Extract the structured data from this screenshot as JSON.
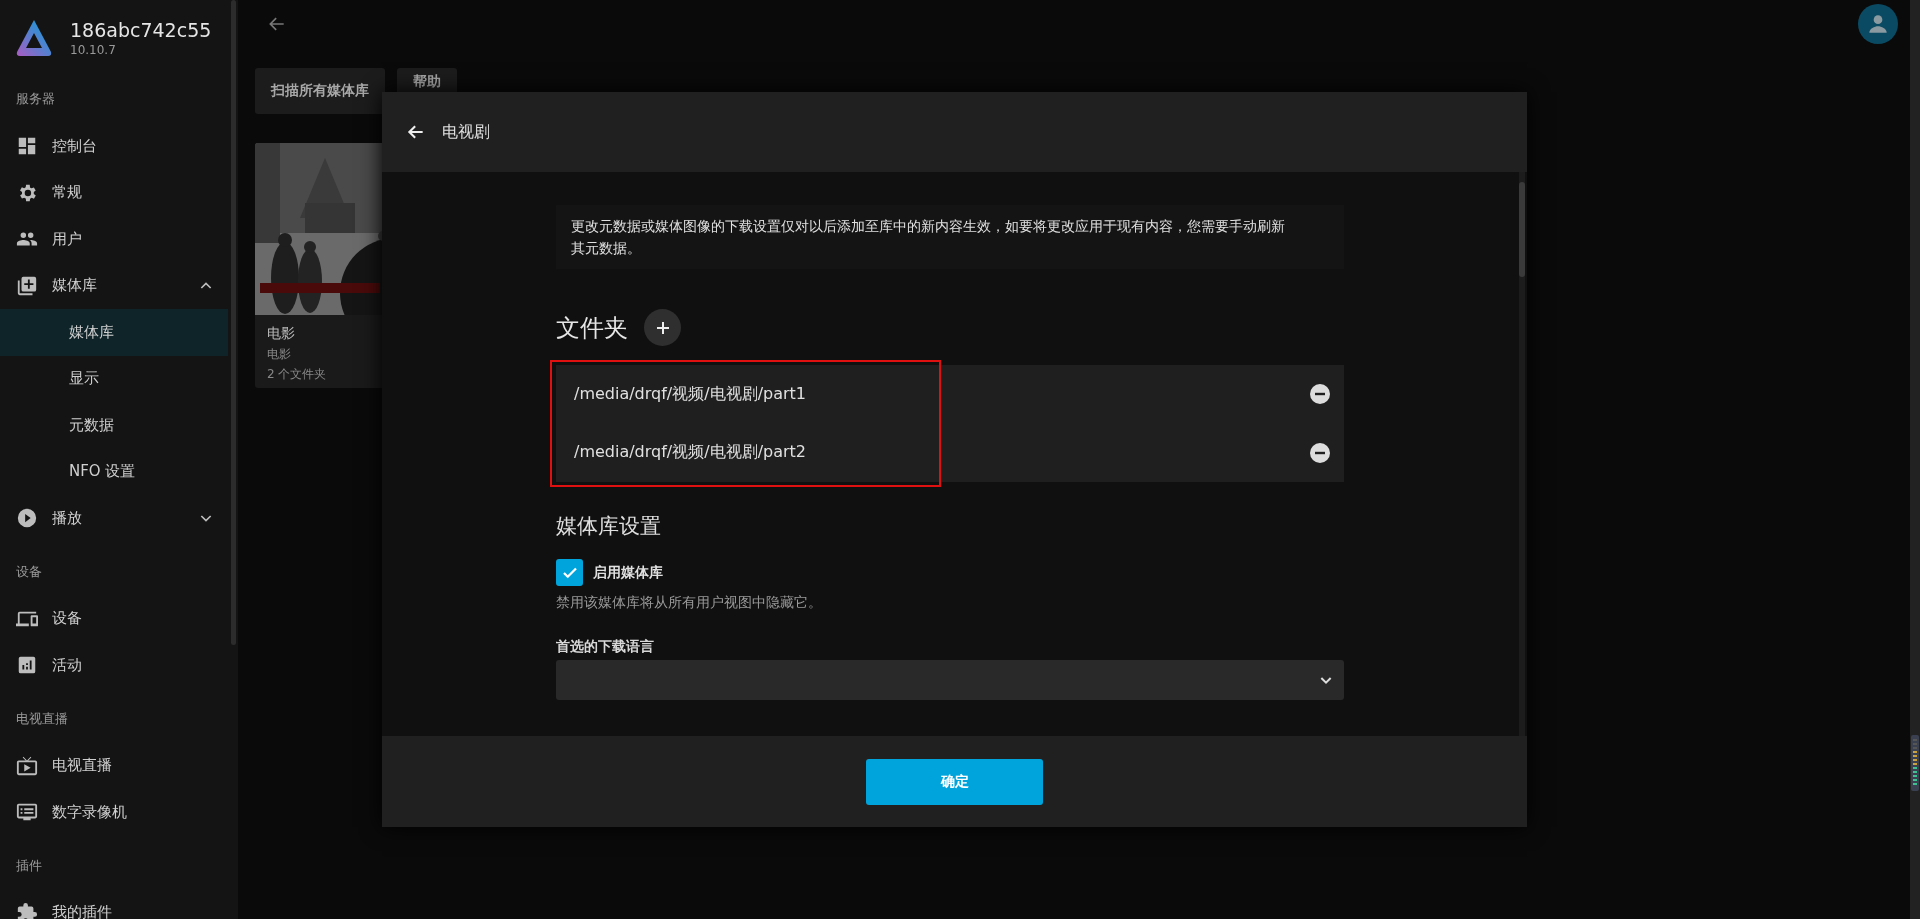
{
  "server": {
    "name": "186abc742c55",
    "version": "10.10.7"
  },
  "sidebar": {
    "sections": [
      {
        "header": "服务器",
        "items": [
          {
            "label": "控制台",
            "selected": false
          },
          {
            "label": "常规",
            "selected": false
          },
          {
            "label": "用户",
            "selected": false
          },
          {
            "label": "媒体库",
            "selected": false,
            "expanded": true,
            "children": [
              {
                "label": "媒体库",
                "selected": true
              },
              {
                "label": "显示",
                "selected": false
              },
              {
                "label": "元数据",
                "selected": false
              },
              {
                "label": "NFO 设置",
                "selected": false
              }
            ]
          },
          {
            "label": "播放",
            "selected": false,
            "expanded": false
          }
        ]
      },
      {
        "header": "设备",
        "items": [
          {
            "label": "设备",
            "selected": false
          },
          {
            "label": "活动",
            "selected": false
          }
        ]
      },
      {
        "header": "电视直播",
        "items": [
          {
            "label": "电视直播",
            "selected": false
          },
          {
            "label": "数字录像机",
            "selected": false
          }
        ]
      },
      {
        "header": "插件",
        "items": [
          {
            "label": "我的插件",
            "selected": false
          }
        ]
      }
    ]
  },
  "toolbar": {
    "buttons": [
      "扫描所有媒体库",
      "帮助"
    ]
  },
  "library_card": {
    "title": "电影",
    "subtitle": "电影",
    "count": "2 个文件夹"
  },
  "dialog": {
    "title": "电视剧",
    "notice": "更改元数据或媒体图像的下载设置仅对以后添加至库中的新内容生效，如要将更改应用于现有内容，您需要手动刷新其元数据。",
    "folders_heading": "文件夹",
    "folders": [
      "/media/drqf/视频/电视剧/part1",
      "/media/drqf/视频/电视剧/part2"
    ],
    "settings_heading": "媒体库设置",
    "enable": {
      "label": "启用媒体库",
      "checked": true,
      "description": "禁用该媒体库将从所有用户视图中隐藏它。"
    },
    "language": {
      "label": "首选的下载语言"
    },
    "ok_button": "确定"
  }
}
